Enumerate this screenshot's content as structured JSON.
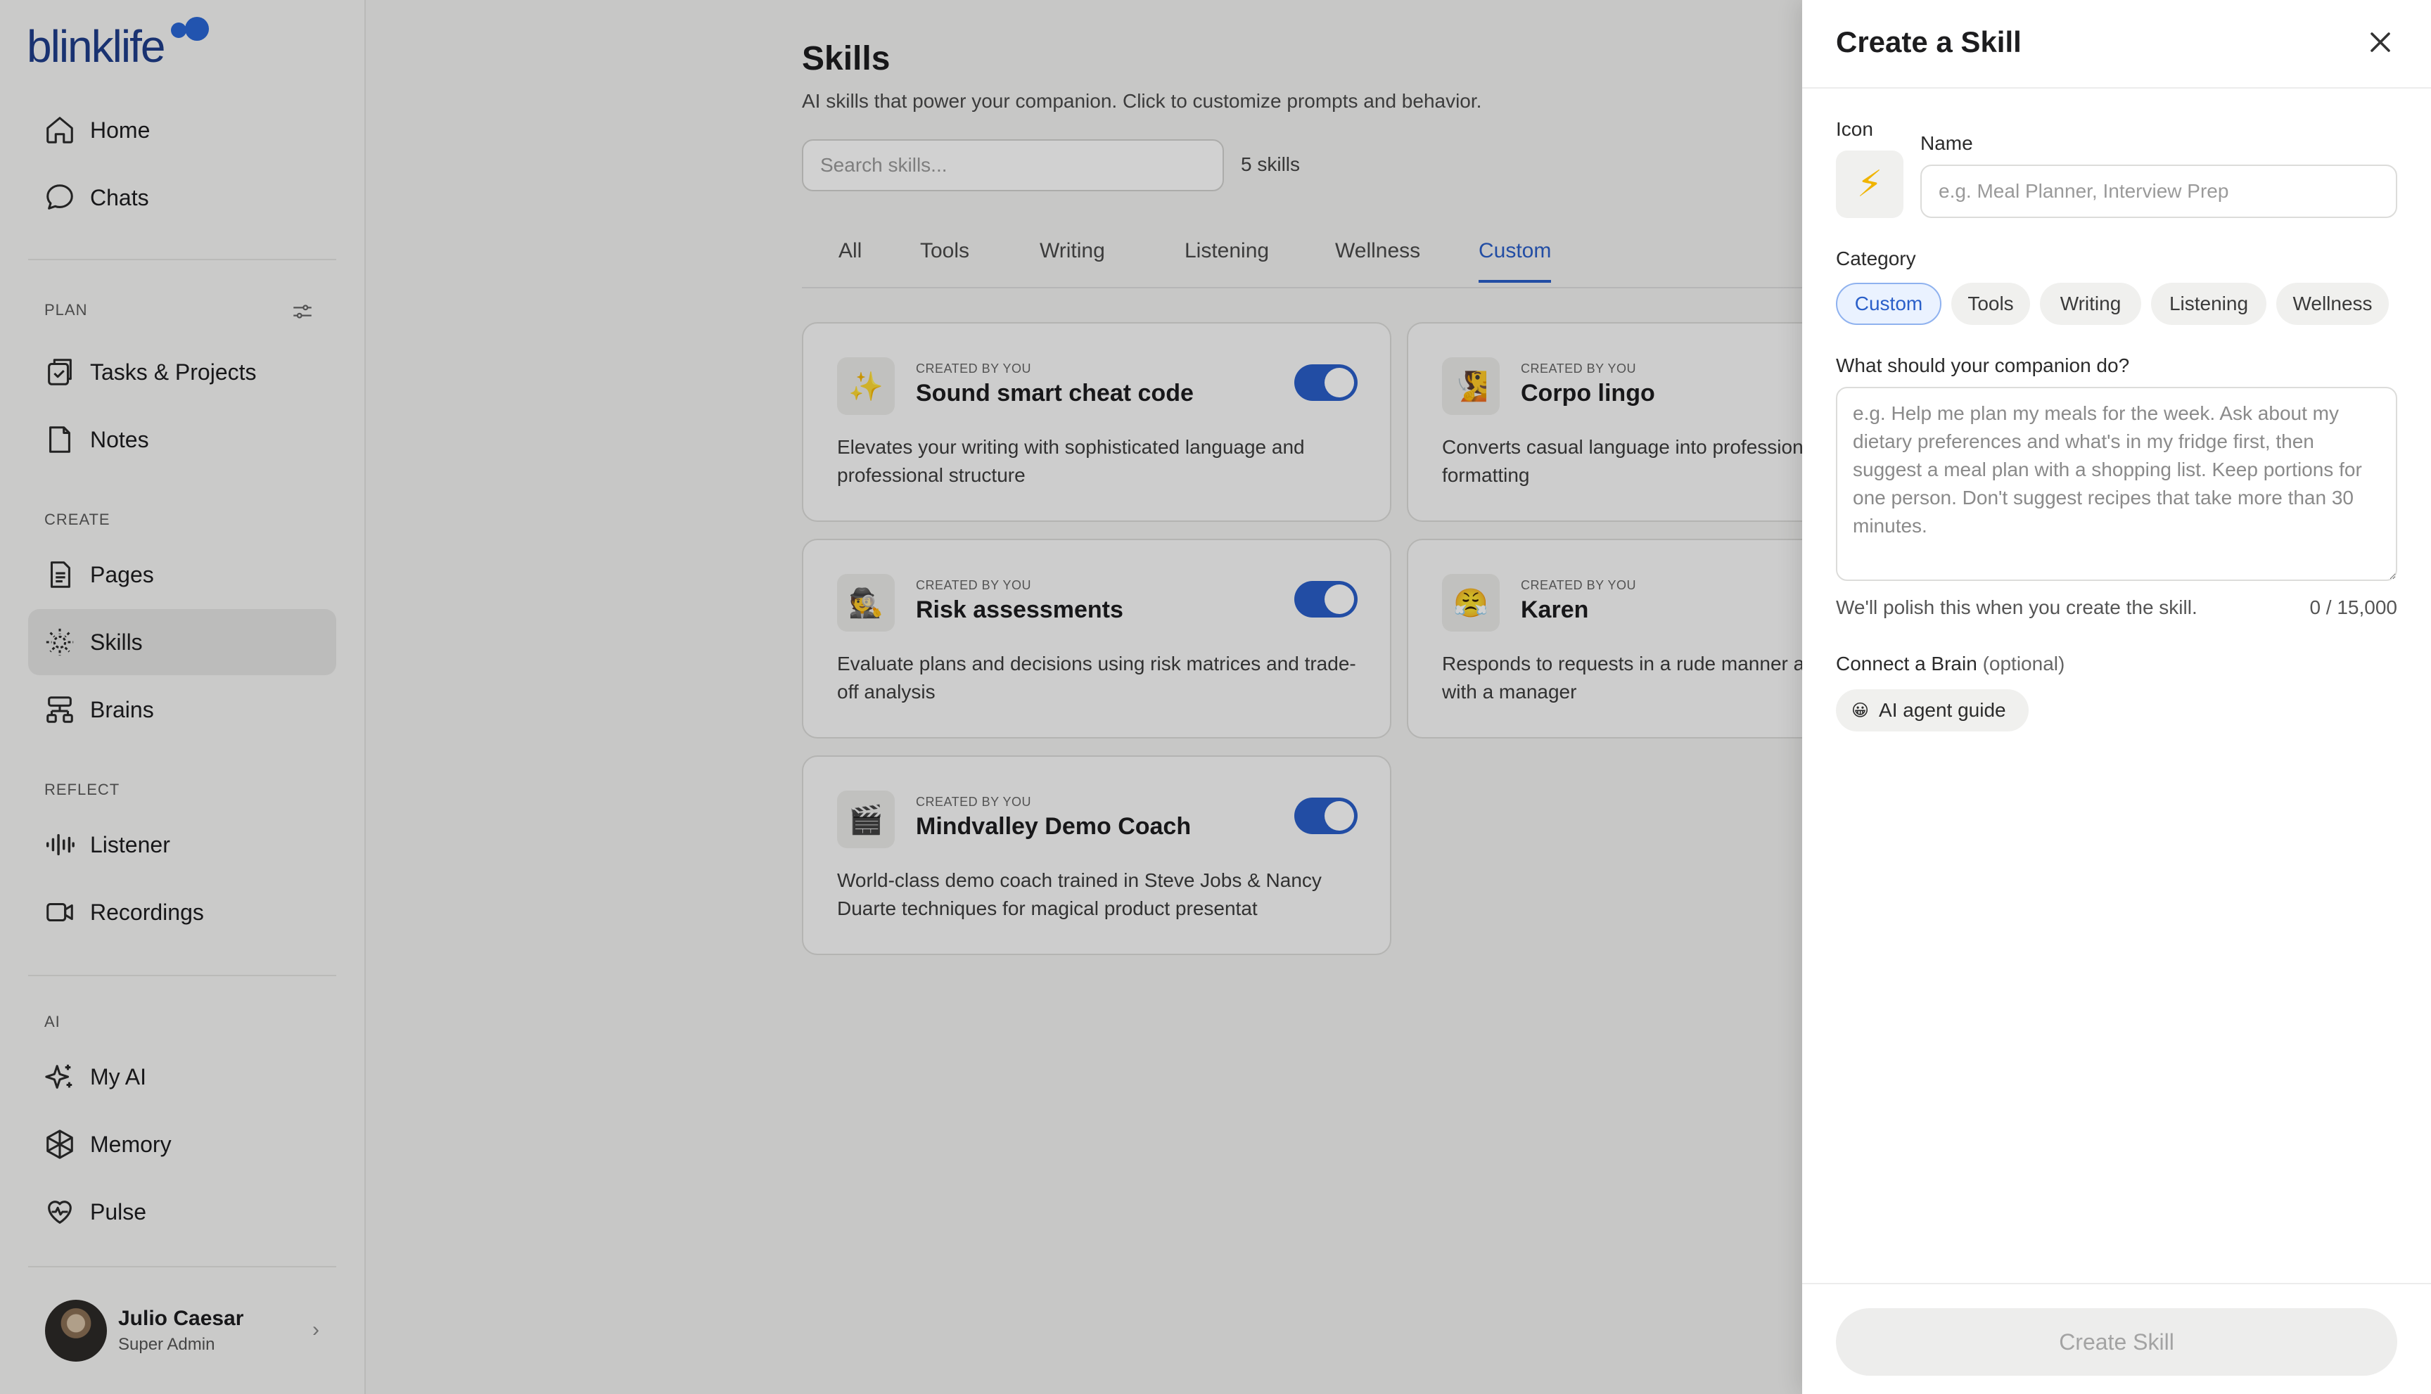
{
  "brand": {
    "logo_text": "blinklife",
    "accent": "#2a5fc9"
  },
  "sidebar": {
    "top_items": [
      {
        "label": "Home",
        "icon": "home-icon"
      },
      {
        "label": "Chats",
        "icon": "chat-bubble-icon"
      }
    ],
    "sections": [
      {
        "label": "PLAN",
        "items": [
          {
            "label": "Tasks & Projects",
            "icon": "tasks-icon"
          },
          {
            "label": "Notes",
            "icon": "note-icon"
          }
        ]
      },
      {
        "label": "CREATE",
        "items": [
          {
            "label": "Pages",
            "icon": "page-icon"
          },
          {
            "label": "Skills",
            "icon": "skills-icon",
            "active": true
          },
          {
            "label": "Brains",
            "icon": "brains-icon"
          }
        ]
      },
      {
        "label": "REFLECT",
        "items": [
          {
            "label": "Listener",
            "icon": "waveform-icon"
          },
          {
            "label": "Recordings",
            "icon": "video-icon"
          }
        ]
      },
      {
        "label": "AI",
        "items": [
          {
            "label": "My AI",
            "icon": "sparkles-icon"
          },
          {
            "label": "Memory",
            "icon": "memory-icon"
          },
          {
            "label": "Pulse",
            "icon": "heart-pulse-icon"
          }
        ]
      }
    ],
    "user": {
      "name": "Julio Caesar",
      "role": "Super Admin"
    }
  },
  "main": {
    "title": "Skills",
    "subtitle": "AI skills that power your companion. Click to customize prompts and behavior.",
    "search_placeholder": "Search skills...",
    "count": "5 skills",
    "tabs": [
      "All",
      "Tools",
      "Writing",
      "Listening",
      "Wellness",
      "Custom"
    ],
    "active_tab": "Custom",
    "cards": [
      {
        "emoji": "✨",
        "by": "CREATED BY YOU",
        "name": "Sound smart cheat code",
        "desc": "Elevates your writing with sophisticated language and professional structure",
        "enabled": true
      },
      {
        "emoji": "🧏",
        "by": "CREATED BY YOU",
        "name": "Corpo lingo",
        "desc": "Converts casual language into professional terminology and formatting",
        "enabled": true
      },
      {
        "emoji": "🕵️",
        "by": "CREATED BY YOU",
        "name": "Risk assessments",
        "desc": "Evaluate plans and decisions using risk matrices and trade-off analysis",
        "enabled": true
      },
      {
        "emoji": "😤",
        "by": "CREATED BY YOU",
        "name": "Karen",
        "desc": "Responds to requests in a rude manner and asks to speak with a manager",
        "enabled": true
      },
      {
        "emoji": "🎬",
        "by": "CREATED BY YOU",
        "name": "Mindvalley Demo Coach",
        "desc": "World-class demo coach trained in Steve Jobs & Nancy Duarte techniques for magical product presentat",
        "enabled": true
      }
    ]
  },
  "drawer": {
    "title": "Create a Skill",
    "icon_label": "Icon",
    "icon_value": "⚡",
    "name_label": "Name",
    "name_placeholder": "e.g. Meal Planner, Interview Prep",
    "category_label": "Category",
    "categories": [
      "Custom",
      "Tools",
      "Writing",
      "Listening",
      "Wellness"
    ],
    "active_category": "Custom",
    "prompt_label": "What should your companion do?",
    "prompt_placeholder": "e.g. Help me plan my meals for the week. Ask about my dietary preferences and what's in my fridge first, then suggest a meal plan with a shopping list. Keep portions for one person. Don't suggest recipes that take more than 30 minutes.",
    "polish_note": "We'll polish this when you create the skill.",
    "char_count": "0 / 15,000",
    "brain_label": "Connect a Brain",
    "brain_optional": "(optional)",
    "brain_chip": {
      "emoji": "😀",
      "label": "AI agent guide"
    },
    "create_button": "Create Skill"
  }
}
